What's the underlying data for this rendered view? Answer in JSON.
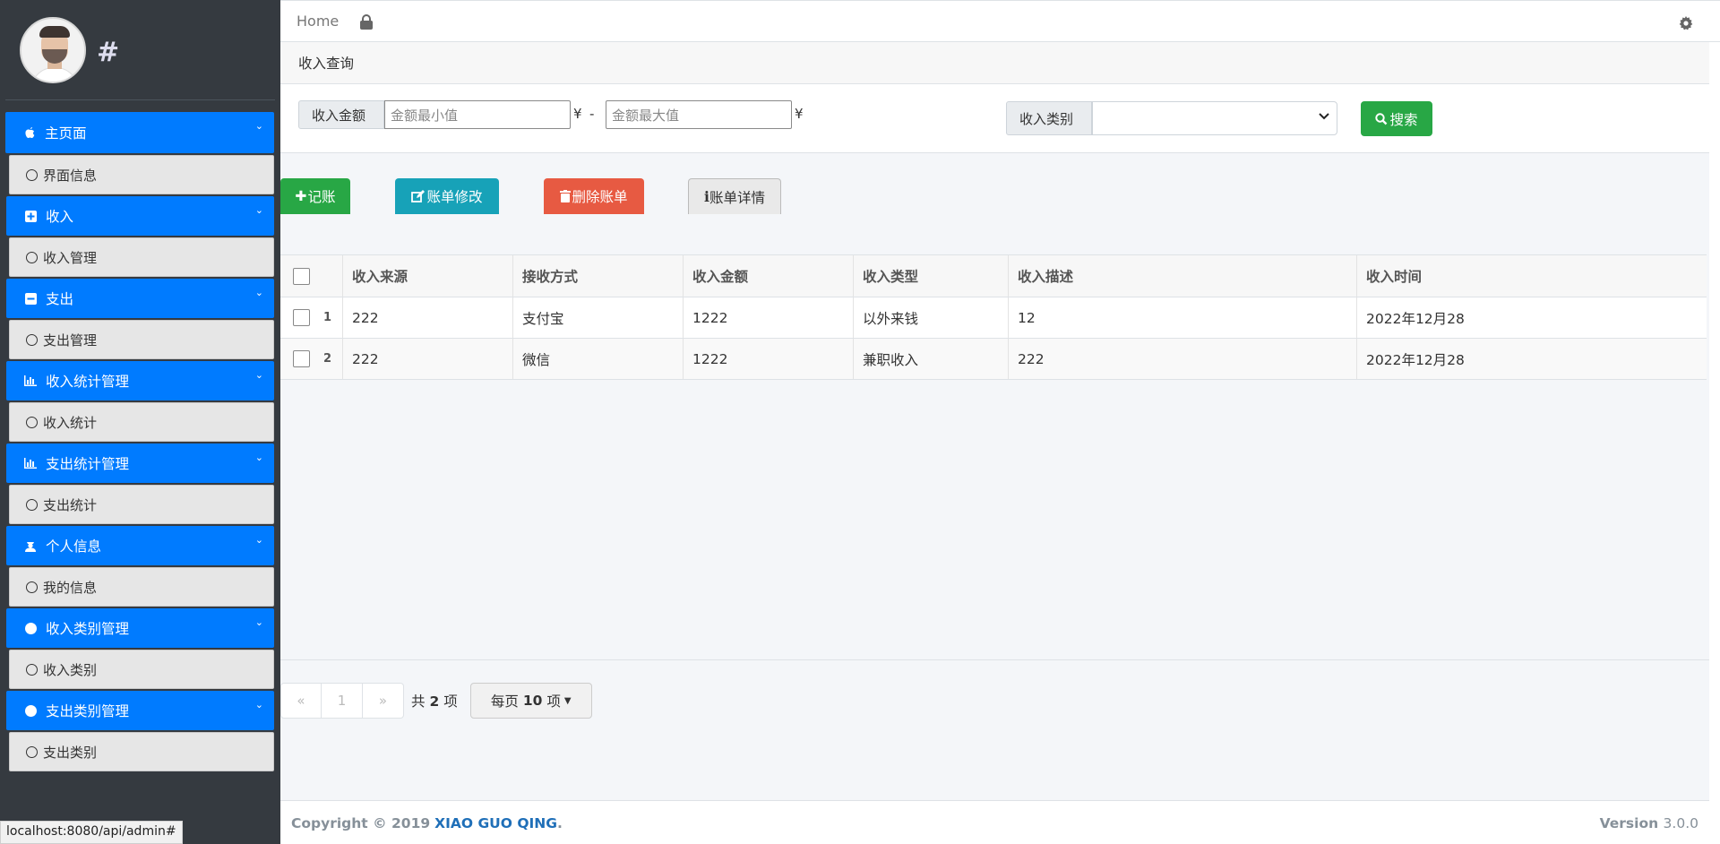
{
  "sidebar": {
    "brand": "#",
    "menu": [
      {
        "head": "主页面",
        "icon": "apple-icon",
        "sub": "界面信息"
      },
      {
        "head": "收入",
        "icon": "plus-square-icon",
        "sub": "收入管理"
      },
      {
        "head": "支出",
        "icon": "minus-square-icon",
        "sub": "支出管理"
      },
      {
        "head": "收入统计管理",
        "icon": "bar-chart-icon",
        "sub": "收入统计"
      },
      {
        "head": "支出统计管理",
        "icon": "bar-chart-icon",
        "sub": "支出统计"
      },
      {
        "head": "个人信息",
        "icon": "user-secret-icon",
        "sub": "我的信息"
      },
      {
        "head": "收入类别管理",
        "icon": "circle-icon",
        "sub": "收入类别"
      },
      {
        "head": "支出类别管理",
        "icon": "circle-icon",
        "sub": "支出类别"
      }
    ]
  },
  "statusbar": {
    "url": "localhost:8080/api/admin#"
  },
  "topnav": {
    "home": "Home"
  },
  "breadcrumb": {
    "title": "收入查询"
  },
  "search": {
    "amount_label": "收入金额",
    "min_placeholder": "金额最小值",
    "max_placeholder": "金额最大值",
    "currency": "¥",
    "dash": "-",
    "category_label": "收入类别",
    "category_value": "",
    "search_button": "搜索"
  },
  "toolbar": {
    "add": "记账",
    "edit": "账单修改",
    "delete": "删除账单",
    "detail": "账单详情"
  },
  "table": {
    "columns": [
      "收入来源",
      "接收方式",
      "收入金额",
      "收入类型",
      "收入描述",
      "收入时间"
    ],
    "rows": [
      {
        "index": "1",
        "cells": [
          "222",
          "支付宝",
          "1222",
          "以外来钱",
          "12",
          "2022年12月28"
        ]
      },
      {
        "index": "2",
        "cells": [
          "222",
          "微信",
          "1222",
          "兼职收入",
          "222",
          "2022年12月28"
        ]
      }
    ]
  },
  "pagination": {
    "prev": "«",
    "page": "1",
    "next": "»",
    "total_prefix": "共",
    "total_count": "2",
    "total_suffix": "项",
    "per_page_prefix": "每页",
    "per_page_count": "10",
    "per_page_suffix": "项"
  },
  "footer": {
    "copyright": "Copyright © 2019",
    "brand": "XIAO GUO QING",
    "dot": ".",
    "version_label": "Version",
    "version_value": "3.0.0"
  },
  "colors": {
    "sidebar_bg": "#353a40",
    "primary": "#007bff",
    "success": "#28a745",
    "info": "#17a2b8",
    "danger": "#e75a42"
  }
}
